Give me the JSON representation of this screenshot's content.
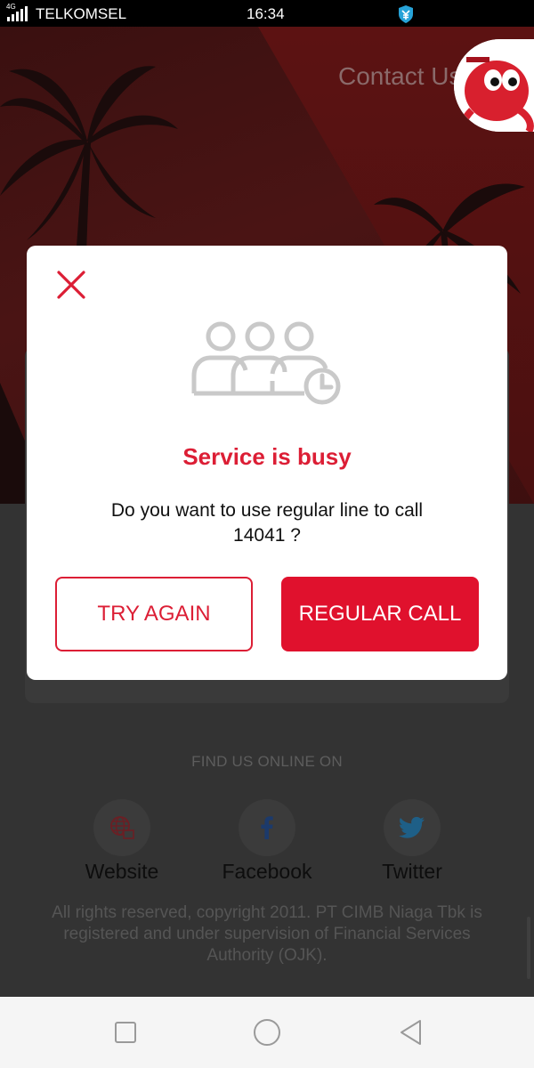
{
  "status_bar": {
    "network": "4G",
    "carrier": "TELKOMSEL",
    "time": "16:34"
  },
  "page": {
    "title": "Contact Us",
    "find_us_label": "FIND US ONLINE ON",
    "social": [
      {
        "label": "Website",
        "icon": "globe-icon"
      },
      {
        "label": "Facebook",
        "icon": "facebook-icon"
      },
      {
        "label": "Twitter",
        "icon": "twitter-icon"
      }
    ],
    "copyright": "All rights reserved, copyright 2011. PT CIMB Niaga Tbk is registered and under supervision of Financial Services Authority (OJK)."
  },
  "dialog": {
    "icon": "busy-queue-icon",
    "title": "Service is busy",
    "message": "Do you want to use regular line to call 14041 ?",
    "try_again_label": "TRY AGAIN",
    "regular_call_label": "REGULAR CALL"
  },
  "colors": {
    "accent": "#dc1e35",
    "button_fill": "#e0112d",
    "dialog_bg": "#ffffff"
  }
}
